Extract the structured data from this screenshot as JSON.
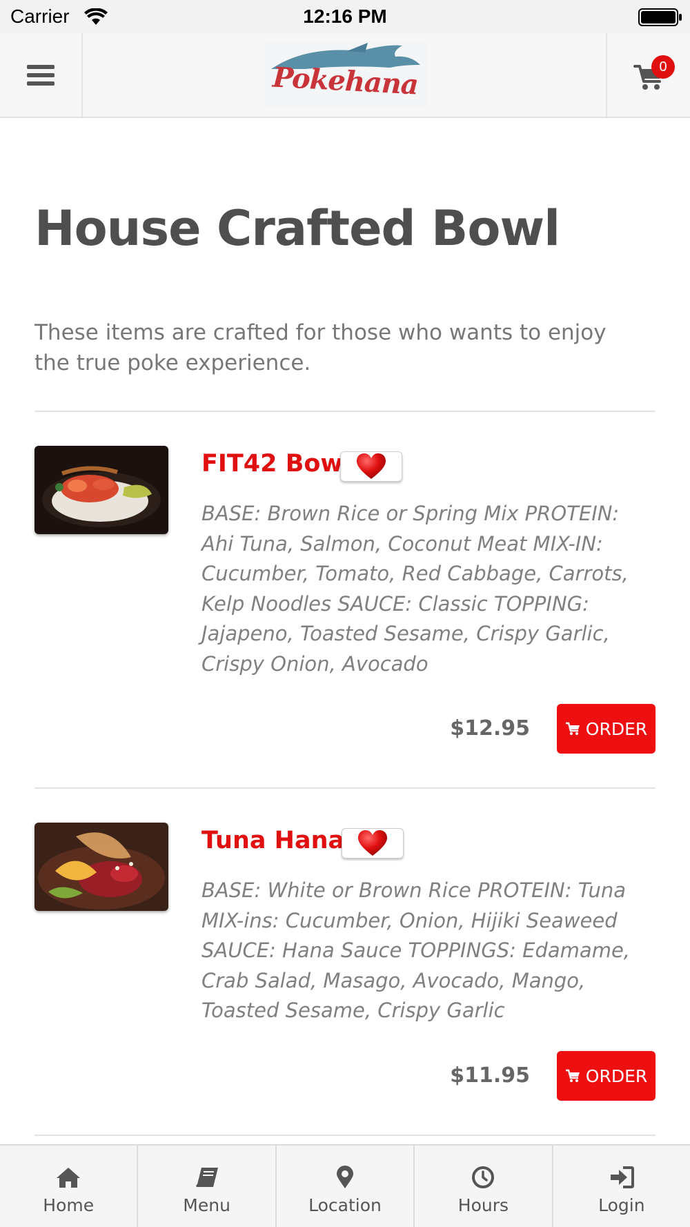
{
  "status_bar": {
    "carrier": "Carrier",
    "time": "12:16 PM"
  },
  "header": {
    "logo_text": "Pokehana",
    "cart_count": "0",
    "colors": {
      "accent": "#e01010",
      "logo_red": "#c9343a",
      "logo_fish": "#5a8fa8"
    }
  },
  "page": {
    "title": "House Crafted Bowl",
    "description": "These items are crafted for those who wants to enjoy the true poke experience."
  },
  "items": [
    {
      "name": "FIT42 Bowl",
      "description": "BASE: Brown Rice or Spring Mix PROTEIN: Ahi Tuna, Salmon, Coconut Meat MIX-IN: Cucumber, Tomato, Red Cabbage, Carrots, Kelp Noodles SAUCE: Classic TOPPING: Jajapeno, Toasted Sesame, Crispy Garlic, Crispy Onion, Avocado",
      "price": "$12.95",
      "order_label": "ORDER",
      "favorite_icon": "heart-icon"
    },
    {
      "name": "Tuna Hana",
      "description": "BASE: White or Brown Rice PROTEIN: Tuna MIX-ins: Cucumber, Onion, Hijiki Seaweed SAUCE: Hana Sauce TOPPINGS: Edamame, Crab Salad, Masago, Avocado, Mango, Toasted Sesame, Crispy Garlic",
      "price": "$11.95",
      "order_label": "ORDER",
      "favorite_icon": "heart-icon"
    }
  ],
  "bottom_nav": [
    {
      "label": "Home",
      "icon": "home-icon"
    },
    {
      "label": "Menu",
      "icon": "book-icon"
    },
    {
      "label": "Location",
      "icon": "map-marker-icon"
    },
    {
      "label": "Hours",
      "icon": "clock-icon"
    },
    {
      "label": "Login",
      "icon": "sign-in-icon"
    }
  ]
}
